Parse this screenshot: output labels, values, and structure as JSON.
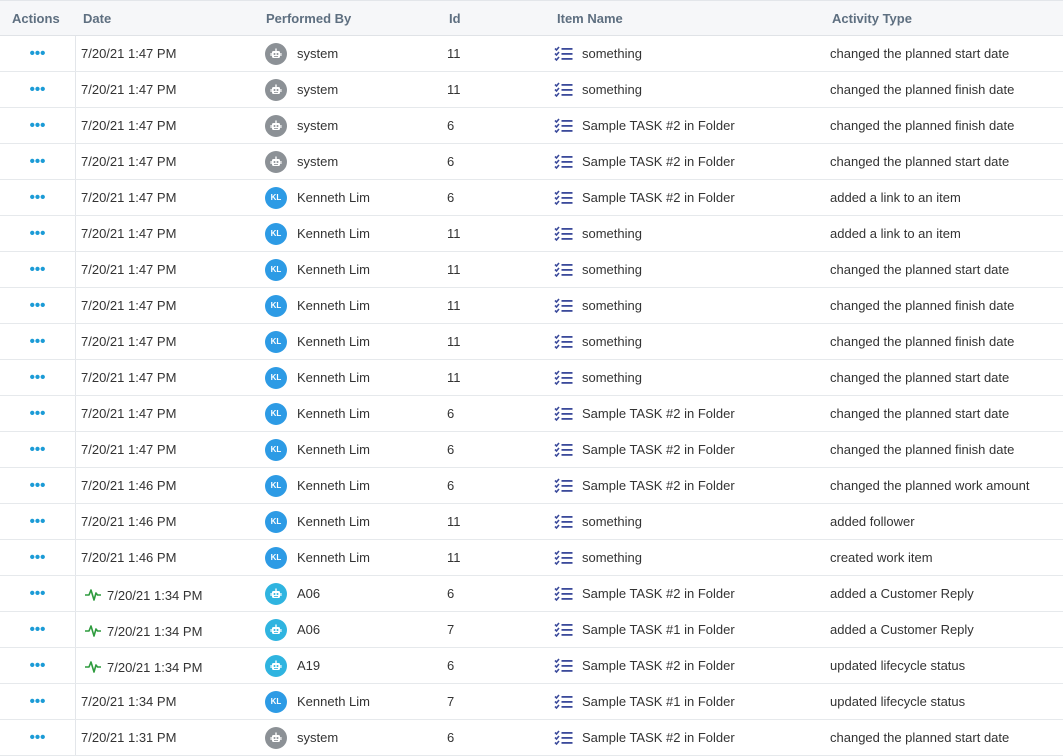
{
  "columns": {
    "actions": "Actions",
    "date": "Date",
    "performed_by": "Performed By",
    "id": "Id",
    "item_name": "Item Name",
    "activity_type": "Activity Type"
  },
  "actions_glyph": "•••",
  "colors": {
    "accent": "#1b9bd6",
    "kl_avatar": "#2d9be5",
    "system_avatar": "#8c9196",
    "robot_avatar": "#2fb4e0",
    "pulse": "#2e9b3e",
    "task_icon": "#3b4a9b"
  },
  "avatar_initials": {
    "kl": "KL"
  },
  "rows": [
    {
      "date": "7/20/21 1:47 PM",
      "pulse": false,
      "user": "system",
      "avatar": "system",
      "id": "11",
      "item": "something",
      "activity": "changed the planned start date"
    },
    {
      "date": "7/20/21 1:47 PM",
      "pulse": false,
      "user": "system",
      "avatar": "system",
      "id": "11",
      "item": "something",
      "activity": "changed the planned finish date"
    },
    {
      "date": "7/20/21 1:47 PM",
      "pulse": false,
      "user": "system",
      "avatar": "system",
      "id": "6",
      "item": "Sample TASK #2 in Folder",
      "activity": "changed the planned finish date"
    },
    {
      "date": "7/20/21 1:47 PM",
      "pulse": false,
      "user": "system",
      "avatar": "system",
      "id": "6",
      "item": "Sample TASK #2 in Folder",
      "activity": "changed the planned start date"
    },
    {
      "date": "7/20/21 1:47 PM",
      "pulse": false,
      "user": "Kenneth Lim",
      "avatar": "kl",
      "id": "6",
      "item": "Sample TASK #2 in Folder",
      "activity": "added a link to an item"
    },
    {
      "date": "7/20/21 1:47 PM",
      "pulse": false,
      "user": "Kenneth Lim",
      "avatar": "kl",
      "id": "11",
      "item": "something",
      "activity": "added a link to an item"
    },
    {
      "date": "7/20/21 1:47 PM",
      "pulse": false,
      "user": "Kenneth Lim",
      "avatar": "kl",
      "id": "11",
      "item": "something",
      "activity": "changed the planned start date"
    },
    {
      "date": "7/20/21 1:47 PM",
      "pulse": false,
      "user": "Kenneth Lim",
      "avatar": "kl",
      "id": "11",
      "item": "something",
      "activity": "changed the planned finish date"
    },
    {
      "date": "7/20/21 1:47 PM",
      "pulse": false,
      "user": "Kenneth Lim",
      "avatar": "kl",
      "id": "11",
      "item": "something",
      "activity": "changed the planned finish date"
    },
    {
      "date": "7/20/21 1:47 PM",
      "pulse": false,
      "user": "Kenneth Lim",
      "avatar": "kl",
      "id": "11",
      "item": "something",
      "activity": "changed the planned start date"
    },
    {
      "date": "7/20/21 1:47 PM",
      "pulse": false,
      "user": "Kenneth Lim",
      "avatar": "kl",
      "id": "6",
      "item": "Sample TASK #2 in Folder",
      "activity": "changed the planned start date"
    },
    {
      "date": "7/20/21 1:47 PM",
      "pulse": false,
      "user": "Kenneth Lim",
      "avatar": "kl",
      "id": "6",
      "item": "Sample TASK #2 in Folder",
      "activity": "changed the planned finish date"
    },
    {
      "date": "7/20/21 1:46 PM",
      "pulse": false,
      "user": "Kenneth Lim",
      "avatar": "kl",
      "id": "6",
      "item": "Sample TASK #2 in Folder",
      "activity": "changed the planned work amount"
    },
    {
      "date": "7/20/21 1:46 PM",
      "pulse": false,
      "user": "Kenneth Lim",
      "avatar": "kl",
      "id": "11",
      "item": "something",
      "activity": "added follower"
    },
    {
      "date": "7/20/21 1:46 PM",
      "pulse": false,
      "user": "Kenneth Lim",
      "avatar": "kl",
      "id": "11",
      "item": "something",
      "activity": "created work item"
    },
    {
      "date": "7/20/21 1:34 PM",
      "pulse": true,
      "user": "A06",
      "avatar": "robot",
      "id": "6",
      "item": "Sample TASK #2 in Folder",
      "activity": "added a Customer Reply"
    },
    {
      "date": "7/20/21 1:34 PM",
      "pulse": true,
      "user": "A06",
      "avatar": "robot",
      "id": "7",
      "item": "Sample TASK #1 in Folder",
      "activity": "added a Customer Reply"
    },
    {
      "date": "7/20/21 1:34 PM",
      "pulse": true,
      "user": "A19",
      "avatar": "robot",
      "id": "6",
      "item": "Sample TASK #2 in Folder",
      "activity": "updated lifecycle status"
    },
    {
      "date": "7/20/21 1:34 PM",
      "pulse": false,
      "user": "Kenneth Lim",
      "avatar": "kl",
      "id": "7",
      "item": "Sample TASK #1 in Folder",
      "activity": "updated lifecycle status"
    },
    {
      "date": "7/20/21 1:31 PM",
      "pulse": false,
      "user": "system",
      "avatar": "system",
      "id": "6",
      "item": "Sample TASK #2 in Folder",
      "activity": "changed the planned start date"
    }
  ]
}
